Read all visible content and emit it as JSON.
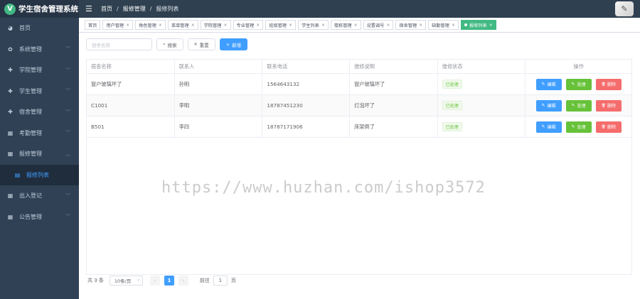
{
  "app": {
    "logo_letter": "V",
    "title": "学生宿舍管理系统"
  },
  "breadcrumb": [
    "首页",
    "报修管理",
    "报修列表"
  ],
  "sidebar": {
    "items": [
      {
        "label": "首页",
        "icon": "dashboard-icon",
        "glyph": "◕",
        "arrow": ""
      },
      {
        "label": "系统管理",
        "icon": "gear-icon",
        "glyph": "✿",
        "arrow": "﹀"
      },
      {
        "label": "学院管理",
        "icon": "plus-circle-icon",
        "glyph": "✚",
        "arrow": "﹀"
      },
      {
        "label": "学生管理",
        "icon": "plus-circle-icon",
        "glyph": "✚",
        "arrow": "﹀"
      },
      {
        "label": "宿舍管理",
        "icon": "plus-circle-icon",
        "glyph": "✚",
        "arrow": "﹀"
      },
      {
        "label": "考勤管理",
        "icon": "grid-icon",
        "glyph": "▦",
        "arrow": "﹀"
      },
      {
        "label": "报修管理",
        "icon": "grid-icon",
        "glyph": "▦",
        "arrow": "︿"
      },
      {
        "label": "报修列表",
        "icon": "list-icon",
        "glyph": "▤",
        "arrow": "",
        "sub": true,
        "active": true
      },
      {
        "label": "出入登记",
        "icon": "grid-icon",
        "glyph": "▦",
        "arrow": "﹀"
      },
      {
        "label": "公告管理",
        "icon": "grid-icon",
        "glyph": "▦",
        "arrow": "﹀"
      }
    ]
  },
  "tags": [
    "首页",
    "用户管理",
    "角色管理",
    "菜单管理",
    "学院管理",
    "专业管理",
    "班级管理",
    "学生列表",
    "楼栋管理",
    "设置调号",
    "宿舍管理",
    "缺勤管理",
    "报修列表"
  ],
  "tag_close": "×",
  "filter": {
    "placeholder": "宿舍名称",
    "search": "搜索",
    "reset": "重置",
    "add": "新增",
    "search_icon": "⌕",
    "reset_icon": "✕",
    "add_icon": "+"
  },
  "table": {
    "headers": [
      "宿舍名称",
      "联系人",
      "联系电话",
      "维修说明",
      "维修状态",
      "操作"
    ],
    "rows": [
      [
        "窗户玻璃坏了",
        "孙明",
        "1564643132",
        "窗户玻璃坏了",
        "已处理"
      ],
      [
        "C1001",
        "李明",
        "18787451230",
        "灯泡坏了",
        "已处理"
      ],
      [
        "B501",
        "李四",
        "18787171906",
        "床架倒了",
        "已处理"
      ]
    ],
    "actions": {
      "edit": "编辑",
      "handle": "处理",
      "delete": "删除",
      "edit_icon": "✎",
      "handle_icon": "✎",
      "delete_icon": "🗑"
    }
  },
  "watermark": "https://www.huzhan.com/ishop3572",
  "pagination": {
    "total": "共 3 条",
    "page_size": "10条/页",
    "prev": "‹",
    "current": "1",
    "next": "›",
    "goto_prefix": "前往",
    "goto_value": "1",
    "goto_suffix": "页",
    "size_caret": "▾"
  },
  "colors": {
    "sidebar": "#304156",
    "primary": "#409eff",
    "success": "#67c23a",
    "danger": "#f56c6c",
    "tag_active": "#42b983"
  }
}
